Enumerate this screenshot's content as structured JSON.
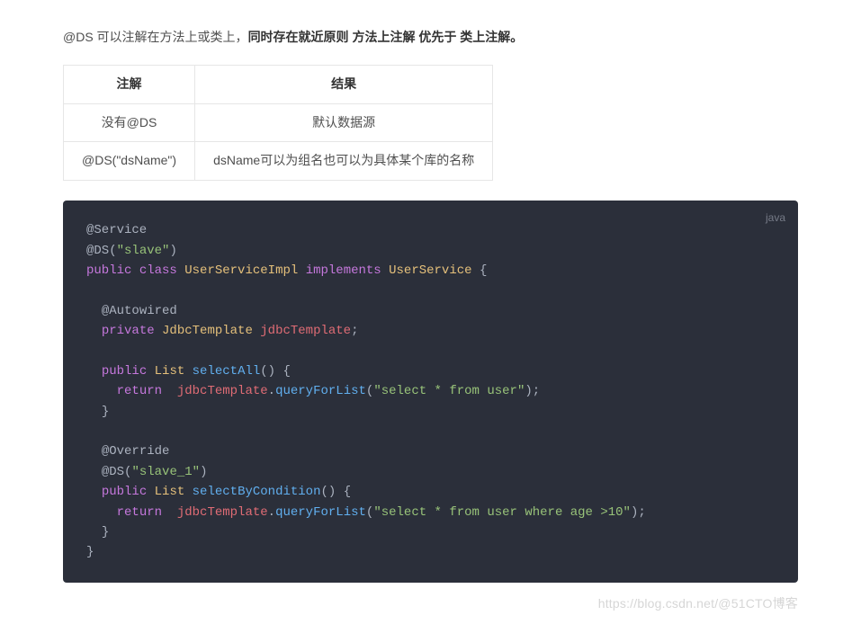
{
  "intro": {
    "prefix": "@DS 可以注解在方法上或类上，",
    "bold": "同时存在就近原则 方法上注解 优先于 类上注解。"
  },
  "table": {
    "headers": [
      "注解",
      "结果"
    ],
    "rows": [
      [
        "没有@DS",
        "默认数据源"
      ],
      [
        "@DS(\"dsName\")",
        "dsName可以为组名也可以为具体某个库的名称"
      ]
    ]
  },
  "code": {
    "lang": "java",
    "tokens": [
      [
        {
          "t": "anno",
          "v": "@Service"
        }
      ],
      [
        {
          "t": "anno",
          "v": "@DS"
        },
        {
          "t": "punc",
          "v": "("
        },
        {
          "t": "str",
          "v": "\"slave\""
        },
        {
          "t": "punc",
          "v": ")"
        }
      ],
      [
        {
          "t": "kw",
          "v": "public"
        },
        {
          "t": "plain",
          "v": " "
        },
        {
          "t": "kw",
          "v": "class"
        },
        {
          "t": "plain",
          "v": " "
        },
        {
          "t": "type",
          "v": "UserServiceImpl"
        },
        {
          "t": "plain",
          "v": " "
        },
        {
          "t": "kw",
          "v": "implements"
        },
        {
          "t": "plain",
          "v": " "
        },
        {
          "t": "type",
          "v": "UserService"
        },
        {
          "t": "plain",
          "v": " "
        },
        {
          "t": "punc",
          "v": "{"
        }
      ],
      [],
      [
        {
          "t": "plain",
          "v": "  "
        },
        {
          "t": "anno",
          "v": "@Autowired"
        }
      ],
      [
        {
          "t": "plain",
          "v": "  "
        },
        {
          "t": "kw",
          "v": "private"
        },
        {
          "t": "plain",
          "v": " "
        },
        {
          "t": "type",
          "v": "JdbcTemplate"
        },
        {
          "t": "plain",
          "v": " "
        },
        {
          "t": "ident",
          "v": "jdbcTemplate"
        },
        {
          "t": "punc",
          "v": ";"
        }
      ],
      [],
      [
        {
          "t": "plain",
          "v": "  "
        },
        {
          "t": "kw",
          "v": "public"
        },
        {
          "t": "plain",
          "v": " "
        },
        {
          "t": "type",
          "v": "List"
        },
        {
          "t": "plain",
          "v": " "
        },
        {
          "t": "method",
          "v": "selectAll"
        },
        {
          "t": "punc",
          "v": "()"
        },
        {
          "t": "plain",
          "v": " "
        },
        {
          "t": "punc",
          "v": "{"
        }
      ],
      [
        {
          "t": "plain",
          "v": "    "
        },
        {
          "t": "kw",
          "v": "return"
        },
        {
          "t": "plain",
          "v": "  "
        },
        {
          "t": "ident",
          "v": "jdbcTemplate"
        },
        {
          "t": "punc",
          "v": "."
        },
        {
          "t": "method",
          "v": "queryForList"
        },
        {
          "t": "punc",
          "v": "("
        },
        {
          "t": "str",
          "v": "\"select * from user\""
        },
        {
          "t": "punc",
          "v": ");"
        }
      ],
      [
        {
          "t": "plain",
          "v": "  "
        },
        {
          "t": "punc",
          "v": "}"
        }
      ],
      [],
      [
        {
          "t": "plain",
          "v": "  "
        },
        {
          "t": "anno",
          "v": "@Override"
        }
      ],
      [
        {
          "t": "plain",
          "v": "  "
        },
        {
          "t": "anno",
          "v": "@DS"
        },
        {
          "t": "punc",
          "v": "("
        },
        {
          "t": "str",
          "v": "\"slave_1\""
        },
        {
          "t": "punc",
          "v": ")"
        }
      ],
      [
        {
          "t": "plain",
          "v": "  "
        },
        {
          "t": "kw",
          "v": "public"
        },
        {
          "t": "plain",
          "v": " "
        },
        {
          "t": "type",
          "v": "List"
        },
        {
          "t": "plain",
          "v": " "
        },
        {
          "t": "method",
          "v": "selectByCondition"
        },
        {
          "t": "punc",
          "v": "()"
        },
        {
          "t": "plain",
          "v": " "
        },
        {
          "t": "punc",
          "v": "{"
        }
      ],
      [
        {
          "t": "plain",
          "v": "    "
        },
        {
          "t": "kw",
          "v": "return"
        },
        {
          "t": "plain",
          "v": "  "
        },
        {
          "t": "ident",
          "v": "jdbcTemplate"
        },
        {
          "t": "punc",
          "v": "."
        },
        {
          "t": "method",
          "v": "queryForList"
        },
        {
          "t": "punc",
          "v": "("
        },
        {
          "t": "str",
          "v": "\"select * from user where age >10\""
        },
        {
          "t": "punc",
          "v": ");"
        }
      ],
      [
        {
          "t": "plain",
          "v": "  "
        },
        {
          "t": "punc",
          "v": "}"
        }
      ],
      [
        {
          "t": "punc",
          "v": "}"
        }
      ]
    ]
  },
  "watermark": "https://blog.csdn.net/@51CTO博客"
}
